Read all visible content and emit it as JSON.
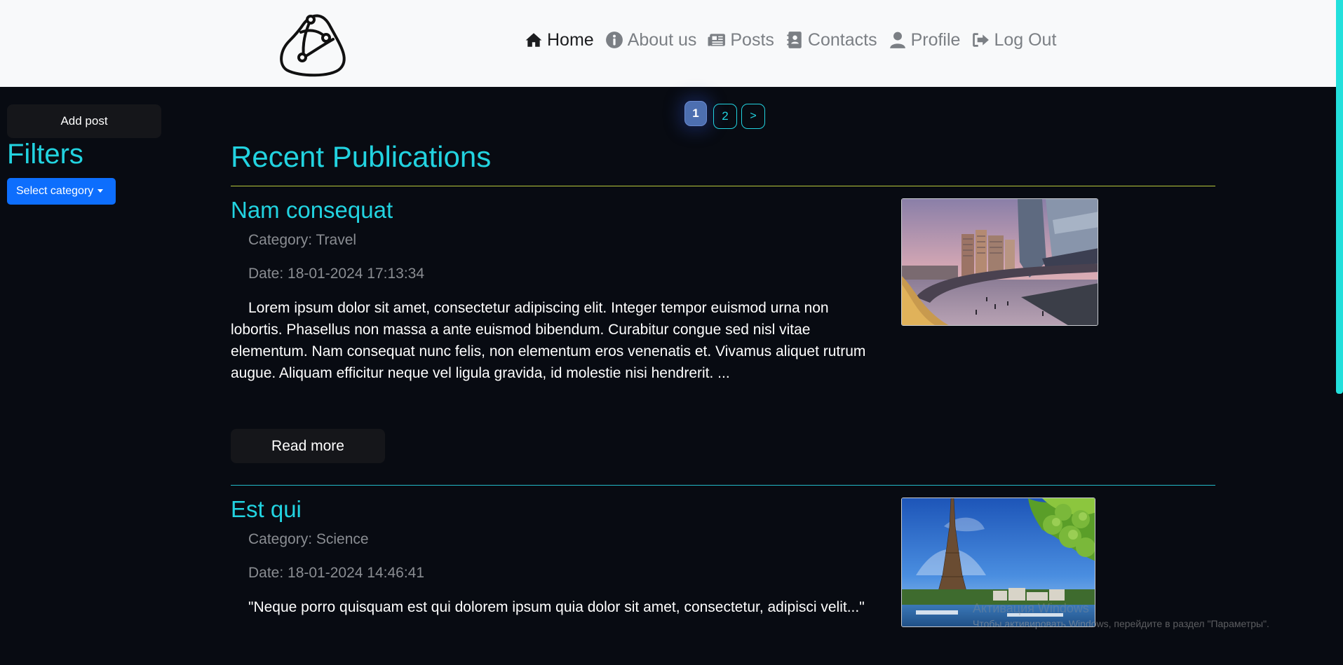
{
  "header": {
    "nav": [
      {
        "label": "Home",
        "icon": "home-icon",
        "active": true
      },
      {
        "label": "About us",
        "icon": "info-icon",
        "active": false
      },
      {
        "label": "Posts",
        "icon": "newspaper-icon",
        "active": false
      },
      {
        "label": "Contacts",
        "icon": "address-book-icon",
        "active": false
      },
      {
        "label": "Profile",
        "icon": "user-icon",
        "active": false
      },
      {
        "label": "Log Out",
        "icon": "sign-out-icon",
        "active": false
      }
    ]
  },
  "sidebar": {
    "add_post_label": "Add post",
    "filters_title": "Filters",
    "category_select_label": "Select category"
  },
  "pagination": {
    "current": "1",
    "pages": [
      "1",
      "2"
    ],
    "next_label": ">"
  },
  "main": {
    "section_title": "Recent Publications",
    "posts": [
      {
        "title": "Nam consequat",
        "category": "Category: Travel",
        "date": "Date: 18-01-2024 17:13:34",
        "excerpt": "Lorem ipsum dolor sit amet, consectetur adipiscing elit. Integer tempor euismod urna non lobortis. Phasellus non massa a ante euismod bibendum. Curabitur congue sed nisl vitae elementum. Nam consequat nunc felis, non elementum eros venenatis et. Vivamus aliquet rutrum augue. Aliquam efficitur neque vel ligula gravida, id molestie nisi hendrerit. ...",
        "read_more_label": "Read more"
      },
      {
        "title": "Est qui",
        "category": "Category: Science",
        "date": "Date: 18-01-2024 14:46:41",
        "excerpt": "\"Neque porro quisquam est qui dolorem ipsum quia dolor sit amet, consectetur, adipisci velit...\""
      }
    ]
  },
  "watermark": {
    "title": "Активация Windows",
    "subtitle": "Чтобы активировать Windows, перейдите в раздел \"Параметры\"."
  },
  "colors": {
    "accent": "#22d3e0",
    "background": "#080b12",
    "header_bg": "#f8f9fa",
    "primary_button": "#0d6efd",
    "divider_1": "#b7c93a",
    "divider_2": "#22b8c8"
  }
}
